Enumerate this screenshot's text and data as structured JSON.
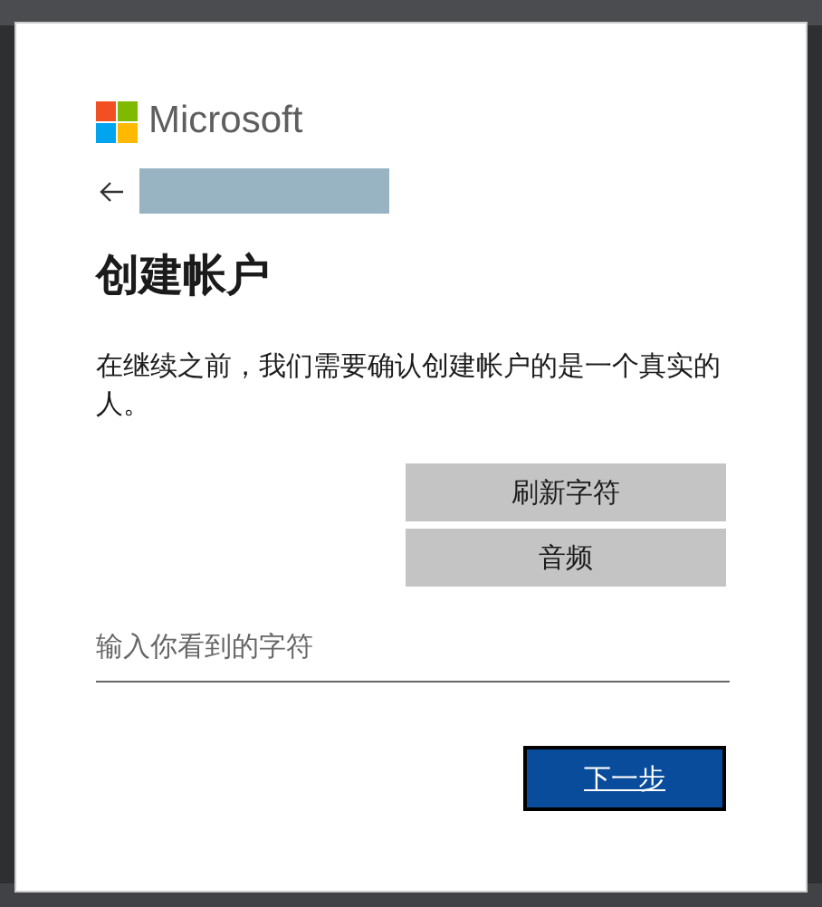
{
  "logo": {
    "text": "Microsoft"
  },
  "heading": "创建帐户",
  "message": "在继续之前，我们需要确认创建帐户的是一个真实的人。",
  "buttons": [
    "刷新字符",
    "音频"
  ],
  "input": {
    "placeholder": "输入你看到的字符"
  },
  "next_button": "下一步"
}
